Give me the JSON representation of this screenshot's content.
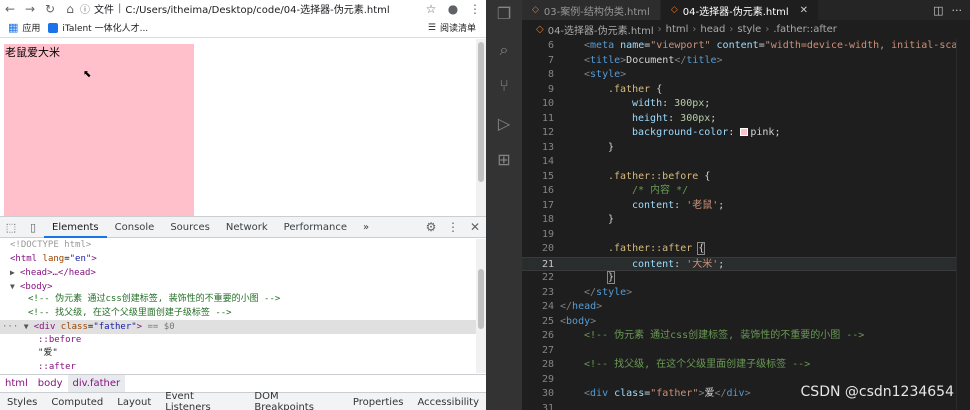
{
  "browser": {
    "url_prefix": "文件",
    "url": "C:/Users/itheima/Desktop/code/04-选择器-伪元素.html",
    "bookmarks": {
      "apps": "应用",
      "italent": "iTalent 一体化人才...",
      "reading_list": "阅读清单"
    },
    "page": {
      "father_text": "老鼠爱大米",
      "father_color": "#ffc0cb"
    }
  },
  "devtools": {
    "tabs": [
      "Elements",
      "Console",
      "Sources",
      "Network",
      "Performance"
    ],
    "more_tabs": "»",
    "dom": {
      "doctype": "<!DOCTYPE html>",
      "html_open": "html",
      "html_lang_attr": "lang",
      "html_lang_val": "\"en\"",
      "head": "<head>…</head>",
      "body": "body",
      "comment1": "<!-- 伪元素 通过css创建标签, 装饰性的不重要的小图 -->",
      "comment2": "<!-- 找父级, 在这个父级里面创建子级标签 -->",
      "div_tag": "div",
      "div_class_attr": "class",
      "div_class_val": "\"father\"",
      "div_selected_marker": "== $0",
      "before": "::before",
      "text_node": "\"爱\"",
      "after": "::after"
    },
    "breadcrumbs": [
      "html",
      "body",
      "div.father"
    ],
    "styles_tabs": [
      "Styles",
      "Computed",
      "Layout",
      "Event Listeners",
      "DOM Breakpoints",
      "Properties",
      "Accessibility"
    ]
  },
  "vscode": {
    "tabs": [
      {
        "label": "03-案例-结构伪类.html",
        "active": false
      },
      {
        "label": "04-选择器-伪元素.html",
        "active": true
      }
    ],
    "breadcrumb": [
      "04-选择器-伪元素.html",
      "html",
      "head",
      "style",
      ".father::after"
    ],
    "current_line": 21,
    "lines": [
      {
        "n": "6",
        "t": "meta"
      },
      {
        "n": "7",
        "t": "title"
      },
      {
        "n": "8",
        "t": "style_open"
      },
      {
        "n": "9",
        "t": "father_open"
      },
      {
        "n": "10",
        "t": "width"
      },
      {
        "n": "11",
        "t": "height"
      },
      {
        "n": "12",
        "t": "bg"
      },
      {
        "n": "13",
        "t": "close1"
      },
      {
        "n": "14",
        "t": "blank"
      },
      {
        "n": "15",
        "t": "before_open"
      },
      {
        "n": "16",
        "t": "comment"
      },
      {
        "n": "17",
        "t": "content_before"
      },
      {
        "n": "18",
        "t": "close1"
      },
      {
        "n": "19",
        "t": "blank"
      },
      {
        "n": "20",
        "t": "after_open"
      },
      {
        "n": "21",
        "t": "content_after"
      },
      {
        "n": "22",
        "t": "close1"
      },
      {
        "n": "23",
        "t": "style_close"
      },
      {
        "n": "24",
        "t": "head_close"
      },
      {
        "n": "25",
        "t": "body_open"
      },
      {
        "n": "26",
        "t": "c1"
      },
      {
        "n": "27",
        "t": "blank"
      },
      {
        "n": "28",
        "t": "c2"
      },
      {
        "n": "29",
        "t": "blank"
      },
      {
        "n": "30",
        "t": "div"
      },
      {
        "n": "31",
        "t": "blank"
      }
    ],
    "code": {
      "meta_name": "\"viewport\"",
      "meta_content": "\"width=device-width, initial-scale",
      "title_text": "Document",
      "father_selector": ".father",
      "width_prop": "width",
      "width_val": "300px",
      "height_prop": "height",
      "height_val": "300px",
      "bg_prop": "background-color",
      "bg_val": "pink",
      "before_selector": ".father::before",
      "comment": "/* 内容 */",
      "content_prop": "content",
      "before_val": "'老鼠'",
      "after_selector": ".father::after",
      "after_val": "'大米'",
      "body_comment1": "<!-- 伪元素 通过css创建标签, 装饰性的不重要的小图 -->",
      "body_comment2": "<!-- 找父级, 在这个父级里面创建子级标签 -->",
      "div_class": "\"father\"",
      "div_text": "爱"
    },
    "watermark": "CSDN @csdn1234654"
  }
}
